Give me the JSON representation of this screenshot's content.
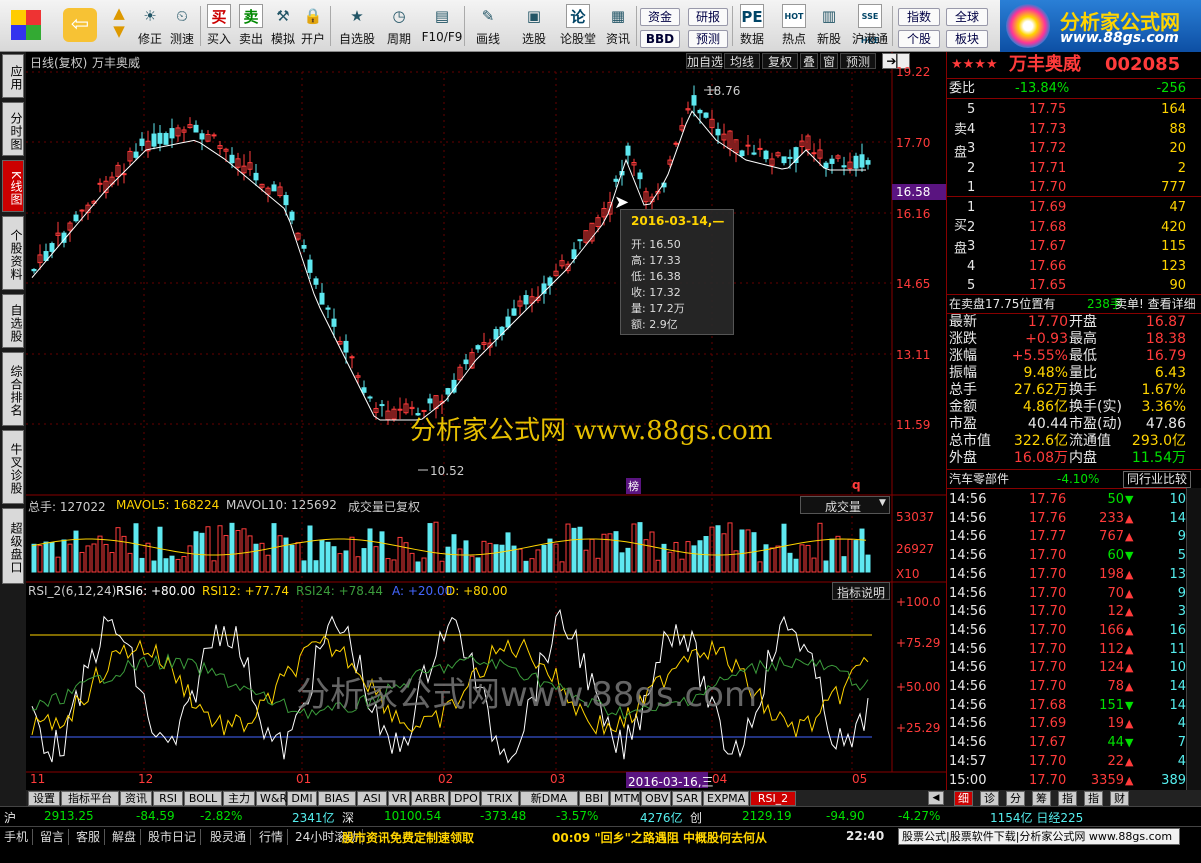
{
  "toolbar": {
    "buttons": [
      {
        "label": "",
        "icon": "app-icon"
      },
      {
        "label": "",
        "icon": "back-icon"
      },
      {
        "label": "修正",
        "icon": "fix-icon"
      },
      {
        "label": "测速",
        "icon": "clock-icon"
      },
      {
        "label": "买入",
        "icon": "buy-icon",
        "glyph": "买"
      },
      {
        "label": "卖出",
        "icon": "sell-icon",
        "glyph": "卖"
      },
      {
        "label": "模拟",
        "icon": "hammer-icon"
      },
      {
        "label": "开户",
        "icon": "lock-icon"
      },
      {
        "label": "自选股",
        "icon": "star-icon"
      },
      {
        "label": "周期",
        "icon": "cycle-icon"
      },
      {
        "label": "F10/F9",
        "icon": "f10-icon"
      },
      {
        "label": "画线",
        "icon": "pen-icon"
      },
      {
        "label": "选股",
        "icon": "select-icon"
      },
      {
        "label": "论股堂",
        "icon": "forum-icon",
        "glyph": "论"
      },
      {
        "label": "资讯",
        "icon": "info-icon"
      },
      {
        "label": "数据",
        "icon": "data-icon",
        "glyph": "PE"
      },
      {
        "label": "热点",
        "icon": "hot-icon",
        "glyph": "HOT"
      },
      {
        "label": "新股",
        "icon": "newstock-icon"
      },
      {
        "label": "沪港通",
        "icon": "hk-icon",
        "glyph": "SSE HKE"
      }
    ],
    "small_buttons": [
      "资金",
      "研报",
      "BBD",
      "预测",
      "指数",
      "全球",
      "个股",
      "板块"
    ],
    "logo_text": "分析家公式网",
    "logo_url": "www.88gs.com"
  },
  "left_tabs": [
    "应用",
    "分时图",
    "K线图",
    "个股资料",
    "自选股",
    "综合排名",
    "牛叉诊股",
    "超级盘口"
  ],
  "chart": {
    "title": "日线(复权)",
    "stock_name": "万丰奥威",
    "top_buttons": [
      "加自选",
      "均线",
      "复权",
      "叠",
      "窗",
      "预测"
    ],
    "price_axis": [
      "19.22",
      "17.70",
      "16.16",
      "14.65",
      "13.11",
      "11.59"
    ],
    "current_price_tag": "16.58",
    "high_label": "18.76",
    "low_label": "10.52",
    "watermark1": "分析家公式网 www.88gs.com",
    "watermark2": "分析家公式网www.88gs.com",
    "tooltip": {
      "date": "2016-03-14,—",
      "lines": [
        "开: 16.50",
        "高: 17.33",
        "低: 16.38",
        "收: 17.32",
        "量: 17.2万",
        "额: 2.9亿"
      ]
    },
    "marker_bang": "榜",
    "marker_q": "q",
    "volume": {
      "legend_total": "总手: 127022",
      "legend_ma5": "MAVOL5: 168224",
      "legend_ma10": "MAVOL10: 125692",
      "legend_note": "成交量已复权",
      "dropdown": "成交量",
      "axis": [
        "53037",
        "26927",
        "X10"
      ]
    },
    "rsi": {
      "legend_name": "RSI_2(6,12,24)",
      "rsi6": "RSI6: +80.00",
      "rsi12": "RSI12: +77.74",
      "rsi24": "RSI24: +78.44",
      "a": "A: +20.00",
      "d": "D: +80.00",
      "help": "指标说明",
      "axis": [
        "+100.0",
        "+75.29",
        "+50.00",
        "+25.29"
      ]
    },
    "date_axis": [
      "11",
      "12",
      "01",
      "02",
      "03",
      "04",
      "05"
    ],
    "date_cursor": "2016-03-16,三"
  },
  "indicator_tabs": [
    "设置",
    "指标平台",
    "资讯",
    "RSI",
    "BOLL",
    "主力",
    "W&R",
    "DMI",
    "BIAS",
    "ASI",
    "VR",
    "ARBR",
    "DPO",
    "TRIX",
    "新DMA",
    "BBI",
    "MTM",
    "OBV",
    "SAR",
    "EXPMA",
    "RSI_2"
  ],
  "panel": {
    "stars": "★★★★",
    "name": "万丰奥威",
    "code": "002085",
    "weibi_label": "委比",
    "weibi_pct": "-13.84%",
    "weibi_val": "-256",
    "sell_label": "卖盘",
    "buy_label": "买盘",
    "asks": [
      {
        "lvl": "5",
        "price": "17.75",
        "vol": "164"
      },
      {
        "lvl": "4",
        "price": "17.73",
        "vol": "88"
      },
      {
        "lvl": "3",
        "price": "17.72",
        "vol": "20"
      },
      {
        "lvl": "2",
        "price": "17.71",
        "vol": "2"
      },
      {
        "lvl": "1",
        "price": "17.70",
        "vol": "777"
      }
    ],
    "bids": [
      {
        "lvl": "1",
        "price": "17.69",
        "vol": "47"
      },
      {
        "lvl": "2",
        "price": "17.68",
        "vol": "420"
      },
      {
        "lvl": "3",
        "price": "17.67",
        "vol": "115"
      },
      {
        "lvl": "4",
        "price": "17.66",
        "vol": "123"
      },
      {
        "lvl": "5",
        "price": "17.65",
        "vol": "90"
      }
    ],
    "notice_left": "在卖盘17.75位置有",
    "notice_mid": "238手",
    "notice_right": "卖单! 查看详细",
    "stats": [
      [
        "最新",
        "17.70",
        "开盘",
        "16.87"
      ],
      [
        "涨跌",
        "+0.93",
        "最高",
        "18.38"
      ],
      [
        "涨幅",
        "+5.55%",
        "最低",
        "16.79"
      ],
      [
        "振幅",
        "9.48%",
        "量比",
        "6.43"
      ],
      [
        "总手",
        "27.62万",
        "换手",
        "1.67%"
      ],
      [
        "金额",
        "4.86亿",
        "换手(实)",
        "3.36%"
      ],
      [
        "市盈",
        "40.44",
        "市盈(动)",
        "47.86"
      ],
      [
        "总市值",
        "322.6亿",
        "流通值",
        "293.0亿"
      ],
      [
        "外盘",
        "16.08万",
        "内盘",
        "11.54万"
      ]
    ],
    "sector_name": "汽车零部件",
    "sector_pct": "-4.10%",
    "sector_btn": "同行业比较",
    "ticks": [
      {
        "t": "14:56",
        "p": "17.76",
        "v": "50",
        "d": "down",
        "n": "10"
      },
      {
        "t": "14:56",
        "p": "17.76",
        "v": "233",
        "d": "up",
        "n": "14"
      },
      {
        "t": "14:56",
        "p": "17.77",
        "v": "767",
        "d": "up",
        "n": "9"
      },
      {
        "t": "14:56",
        "p": "17.70",
        "v": "60",
        "d": "down",
        "n": "5"
      },
      {
        "t": "14:56",
        "p": "17.70",
        "v": "198",
        "d": "up",
        "n": "13"
      },
      {
        "t": "14:56",
        "p": "17.70",
        "v": "70",
        "d": "up",
        "n": "9"
      },
      {
        "t": "14:56",
        "p": "17.70",
        "v": "12",
        "d": "up",
        "n": "3"
      },
      {
        "t": "14:56",
        "p": "17.70",
        "v": "166",
        "d": "up",
        "n": "16"
      },
      {
        "t": "14:56",
        "p": "17.70",
        "v": "112",
        "d": "up",
        "n": "11"
      },
      {
        "t": "14:56",
        "p": "17.70",
        "v": "124",
        "d": "up",
        "n": "10"
      },
      {
        "t": "14:56",
        "p": "17.70",
        "v": "78",
        "d": "up",
        "n": "14"
      },
      {
        "t": "14:56",
        "p": "17.68",
        "v": "151",
        "d": "down",
        "n": "14"
      },
      {
        "t": "14:56",
        "p": "17.69",
        "v": "19",
        "d": "up",
        "n": "4"
      },
      {
        "t": "14:56",
        "p": "17.67",
        "v": "44",
        "d": "down",
        "n": "7"
      },
      {
        "t": "14:57",
        "p": "17.70",
        "v": "22",
        "d": "up",
        "n": "4"
      },
      {
        "t": "15:00",
        "p": "17.70",
        "v": "3359",
        "d": "up",
        "n": "389"
      }
    ],
    "bottom_tabs": [
      "细",
      "诊",
      "分",
      "筹",
      "指",
      "指",
      "财"
    ]
  },
  "ticker": {
    "sh_label": "沪",
    "sh_index": "2913.25",
    "sh_chg": "-84.59",
    "sh_pct": "-2.82%",
    "sh_amt": "2341亿",
    "sz_label": "深",
    "sz_index": "10100.54",
    "sz_chg": "-373.48",
    "sz_pct": "-3.57%",
    "sz_amt": "4276亿",
    "cy_label": "创",
    "cy_index": "2129.19",
    "cy_chg": "-94.90",
    "cy_pct": "-4.27%",
    "extra": "1154亿 日经225"
  },
  "status": {
    "tabs": [
      "手机",
      "留言",
      "客服",
      "解盘",
      "股市日记",
      "股灵通",
      "行情",
      "24小时滚动"
    ],
    "news_left": "股市资讯免费定制速领取",
    "news_mid": "00:09 \"回乡\"之路遇阻 中概股何去何从",
    "time": "22:40",
    "ad": "股票公式|股票软件下载|分析家公式网 www.88gs.com"
  },
  "colors": {
    "up": "#ff3b3b",
    "down": "#5ee8f0",
    "ma": "#ffffff",
    "yellow": "#ffd400",
    "rsi24": "#3c9d3c",
    "purple": "#5a1480"
  }
}
